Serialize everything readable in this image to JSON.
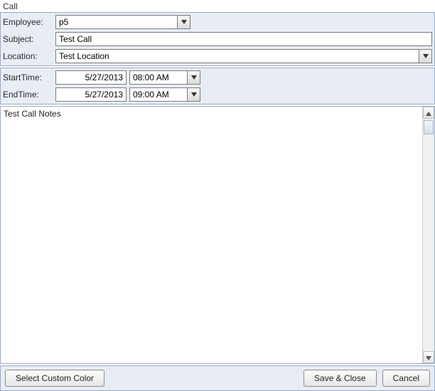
{
  "window": {
    "title": "Call"
  },
  "fields": {
    "employee_label": "Employee:",
    "employee_value": "p5",
    "subject_label": "Subject:",
    "subject_value": "Test Call",
    "location_label": "Location:",
    "location_value": "Test Location",
    "start_label": "StartTime:",
    "start_date": "5/27/2013",
    "start_time": "08:00 AM",
    "end_label": "EndTime:",
    "end_date": "5/27/2013",
    "end_time": "09:00 AM"
  },
  "notes": "Test Call Notes",
  "buttons": {
    "select_color": "Select Custom Color",
    "save_close": "Save & Close",
    "cancel": "Cancel"
  }
}
